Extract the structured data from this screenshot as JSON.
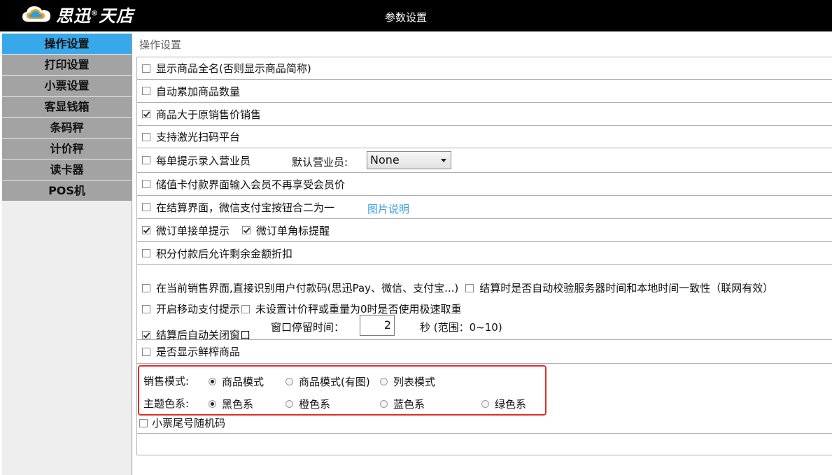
{
  "header": {
    "logo_text": "思迅",
    "logo_text2": "天店",
    "logo_reg": "®",
    "title": "参数设置"
  },
  "sidebar": {
    "items": [
      {
        "label": "操作设置",
        "active": true
      },
      {
        "label": "打印设置",
        "active": false
      },
      {
        "label": "小票设置",
        "active": false
      },
      {
        "label": "客显钱箱",
        "active": false
      },
      {
        "label": "条码秤",
        "active": false
      },
      {
        "label": "计价秤",
        "active": false
      },
      {
        "label": "读卡器",
        "active": false
      },
      {
        "label": "POS机",
        "active": false
      }
    ]
  },
  "main": {
    "title": "操作设置",
    "options": {
      "full_name": {
        "label": "显示商品全名(否则显示商品简称)",
        "checked": false
      },
      "auto_accumulate": {
        "label": "自动累加商品数量",
        "checked": false
      },
      "above_price": {
        "label": "商品大于原销售价销售",
        "checked": true
      },
      "laser_scan": {
        "label": "支持激光扫码平台",
        "checked": false
      },
      "prompt_clerk": {
        "label": "每单提示录入营业员",
        "checked": false
      },
      "default_clerk_label": "默认营业员:",
      "default_clerk_value": "None",
      "stored_card": {
        "label": "储值卡付款界面输入会员不再享受会员价",
        "checked": false
      },
      "merge_pay": {
        "label": "在结算界面，微信支付宝按钮合二为一",
        "checked": false
      },
      "merge_pay_link": "图片说明",
      "wx_order_prompt": {
        "label": "微订单接单提示",
        "checked": true
      },
      "wx_order_badge": {
        "label": "微订单角标提醒",
        "checked": true
      },
      "points_discount": {
        "label": "积分付款后允许剩余金额折扣",
        "checked": false
      },
      "scan_paycode": {
        "label": "在当前销售界面,直接识别用户付款码(思迅Pay、微信、支付宝...)",
        "checked": false
      },
      "verify_time": {
        "label": "结算时是否自动校验服务器时间和本地时间一致性（联网有效）",
        "checked": false
      },
      "mobile_pay_prompt": {
        "label": "开启移动支付提示",
        "checked": false
      },
      "fast_weigh": {
        "label": "未设置计价秤或重量为0时是否使用极速取重",
        "checked": false
      },
      "auto_close": {
        "label": "结算后自动关闭窗口",
        "checked": true
      },
      "stay_time_label": "窗口停留时间：",
      "stay_time_value": "2",
      "stay_time_unit": "秒 (范围：0~10)",
      "show_fresh": {
        "label": "是否显示鲜榨商品",
        "checked": false
      },
      "receipt_random": {
        "label": "小票尾号随机码",
        "checked": false
      }
    },
    "sales_mode": {
      "label": "销售模式:",
      "options": [
        "商品模式",
        "商品模式(有图)",
        "列表模式"
      ],
      "selected": 0
    },
    "theme": {
      "label": "主题色系:",
      "options": [
        "黑色系",
        "橙色系",
        "蓝色系",
        "绿色系"
      ],
      "selected": 0
    }
  },
  "colors": {
    "accent": "#37a8ea",
    "sidebar_item": "#a3a3a3",
    "highlight_box": "#e52b2b",
    "link": "#3aa0e0"
  }
}
